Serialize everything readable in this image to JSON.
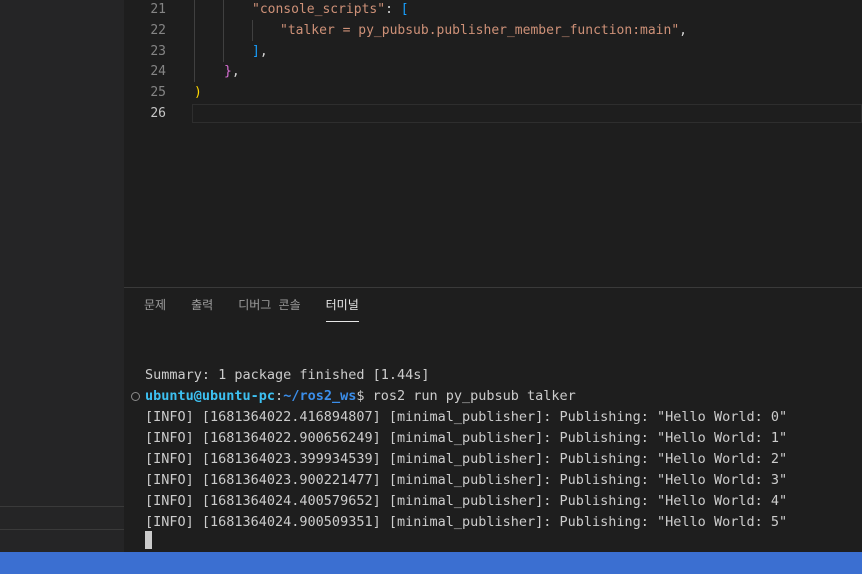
{
  "editor": {
    "lines": [
      {
        "num": "21",
        "parts": [
          [
            "s-str",
            "\"console_scripts\""
          ],
          [
            "s-plain",
            ": "
          ],
          [
            "s-brk3",
            "["
          ]
        ]
      },
      {
        "num": "22",
        "parts": [
          [
            "s-str",
            "\"talker = py_pubsub.publisher_member_function:main\""
          ],
          [
            "s-plain",
            ","
          ]
        ]
      },
      {
        "num": "23",
        "parts": [
          [
            "s-brk3",
            "]"
          ],
          [
            "s-plain",
            ","
          ]
        ]
      },
      {
        "num": "24",
        "parts": [
          [
            "s-brk2",
            "}"
          ],
          [
            "s-plain",
            ","
          ]
        ]
      },
      {
        "num": "25",
        "parts": [
          [
            "s-brk1",
            ")"
          ]
        ]
      },
      {
        "num": "26",
        "parts": []
      }
    ]
  },
  "panel": {
    "tabs": [
      {
        "label": "문제",
        "active": false
      },
      {
        "label": "출력",
        "active": false
      },
      {
        "label": "디버그 콘솔",
        "active": false
      },
      {
        "label": "터미널",
        "active": true
      }
    ]
  },
  "terminal": {
    "summary": "Summary: 1 package finished [1.44s]",
    "prompt_user": "ubuntu@ubuntu-pc",
    "prompt_sep": ":",
    "prompt_path": "~/ros2_ws",
    "prompt_cmd": "$ ros2 run py_pubsub talker",
    "logs": [
      "[INFO] [1681364022.416894807] [minimal_publisher]: Publishing: \"Hello World: 0\"",
      "[INFO] [1681364022.900656249] [minimal_publisher]: Publishing: \"Hello World: 1\"",
      "[INFO] [1681364023.399934539] [minimal_publisher]: Publishing: \"Hello World: 2\"",
      "[INFO] [1681364023.900221477] [minimal_publisher]: Publishing: \"Hello World: 3\"",
      "[INFO] [1681364024.400579652] [minimal_publisher]: Publishing: \"Hello World: 4\"",
      "[INFO] [1681364024.900509351] [minimal_publisher]: Publishing: \"Hello World: 5\""
    ]
  },
  "colors": {
    "statusbar": "#3b6fd1",
    "background": "#1e1e1e"
  }
}
